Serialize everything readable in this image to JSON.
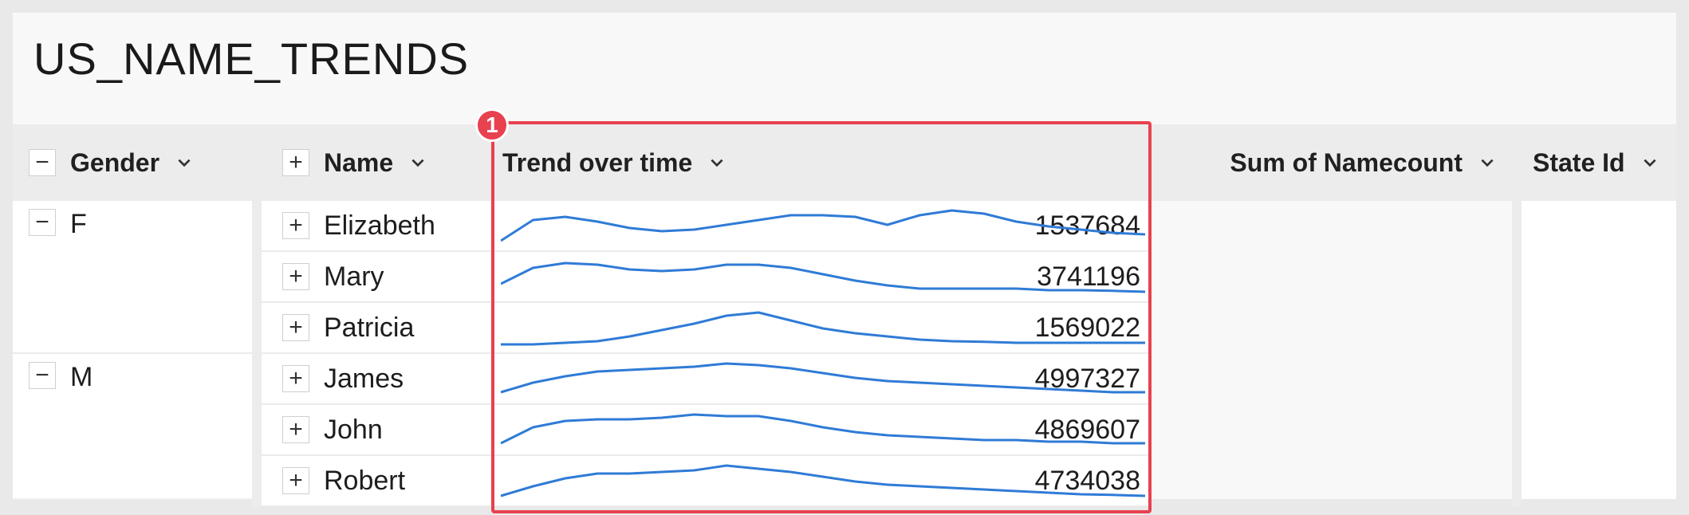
{
  "workbook": {
    "title": "US_NAME_TRENDS"
  },
  "columns": {
    "gender": "Gender",
    "name": "Name",
    "trend": "Trend over time",
    "sum": "Sum of Namecount",
    "state": "State Id"
  },
  "annotation": {
    "badge": "1"
  },
  "groups": [
    {
      "gender": "F",
      "rows": [
        {
          "name": "Elizabeth",
          "sum": "1537684"
        },
        {
          "name": "Mary",
          "sum": "3741196"
        },
        {
          "name": "Patricia",
          "sum": "1569022"
        }
      ]
    },
    {
      "gender": "M",
      "rows": [
        {
          "name": "James",
          "sum": "4997327"
        },
        {
          "name": "John",
          "sum": "4869607"
        },
        {
          "name": "Robert",
          "sum": "4734038"
        }
      ]
    }
  ],
  "icons": {
    "expand": "plus-icon",
    "collapse": "minus-icon",
    "menu": "chevron-down-icon"
  },
  "colors": {
    "accent": "#e8414f",
    "sparkline": "#2f7bd6"
  },
  "chart_data": {
    "type": "line",
    "x": [
      0,
      1,
      2,
      3,
      4,
      5,
      6,
      7,
      8,
      9,
      10,
      11,
      12,
      13,
      14,
      15,
      16,
      17,
      18,
      19,
      20
    ],
    "series": [
      {
        "name": "Elizabeth",
        "values": [
          0.05,
          0.7,
          0.8,
          0.65,
          0.45,
          0.35,
          0.4,
          0.55,
          0.7,
          0.85,
          0.85,
          0.8,
          0.55,
          0.85,
          1.0,
          0.9,
          0.65,
          0.5,
          0.4,
          0.3,
          0.25
        ]
      },
      {
        "name": "Mary",
        "values": [
          0.3,
          0.8,
          0.95,
          0.9,
          0.75,
          0.7,
          0.75,
          0.9,
          0.9,
          0.8,
          0.6,
          0.4,
          0.25,
          0.15,
          0.15,
          0.15,
          0.15,
          0.1,
          0.1,
          0.08,
          0.05
        ]
      },
      {
        "name": "Patricia",
        "values": [
          0.0,
          0.0,
          0.05,
          0.1,
          0.25,
          0.45,
          0.65,
          0.9,
          1.0,
          0.75,
          0.5,
          0.35,
          0.25,
          0.15,
          0.1,
          0.08,
          0.05,
          0.05,
          0.05,
          0.05,
          0.05
        ]
      },
      {
        "name": "James",
        "values": [
          0.1,
          0.4,
          0.6,
          0.75,
          0.8,
          0.85,
          0.9,
          1.0,
          0.95,
          0.85,
          0.7,
          0.55,
          0.45,
          0.4,
          0.35,
          0.3,
          0.25,
          0.2,
          0.15,
          0.1,
          0.1
        ]
      },
      {
        "name": "John",
        "values": [
          0.1,
          0.6,
          0.8,
          0.85,
          0.85,
          0.9,
          1.0,
          0.95,
          0.95,
          0.8,
          0.6,
          0.45,
          0.35,
          0.3,
          0.25,
          0.2,
          0.2,
          0.15,
          0.15,
          0.1,
          0.1
        ]
      },
      {
        "name": "Robert",
        "values": [
          0.05,
          0.35,
          0.6,
          0.75,
          0.75,
          0.8,
          0.85,
          1.0,
          0.9,
          0.8,
          0.65,
          0.5,
          0.4,
          0.35,
          0.3,
          0.25,
          0.2,
          0.15,
          0.1,
          0.08,
          0.05
        ]
      }
    ]
  }
}
